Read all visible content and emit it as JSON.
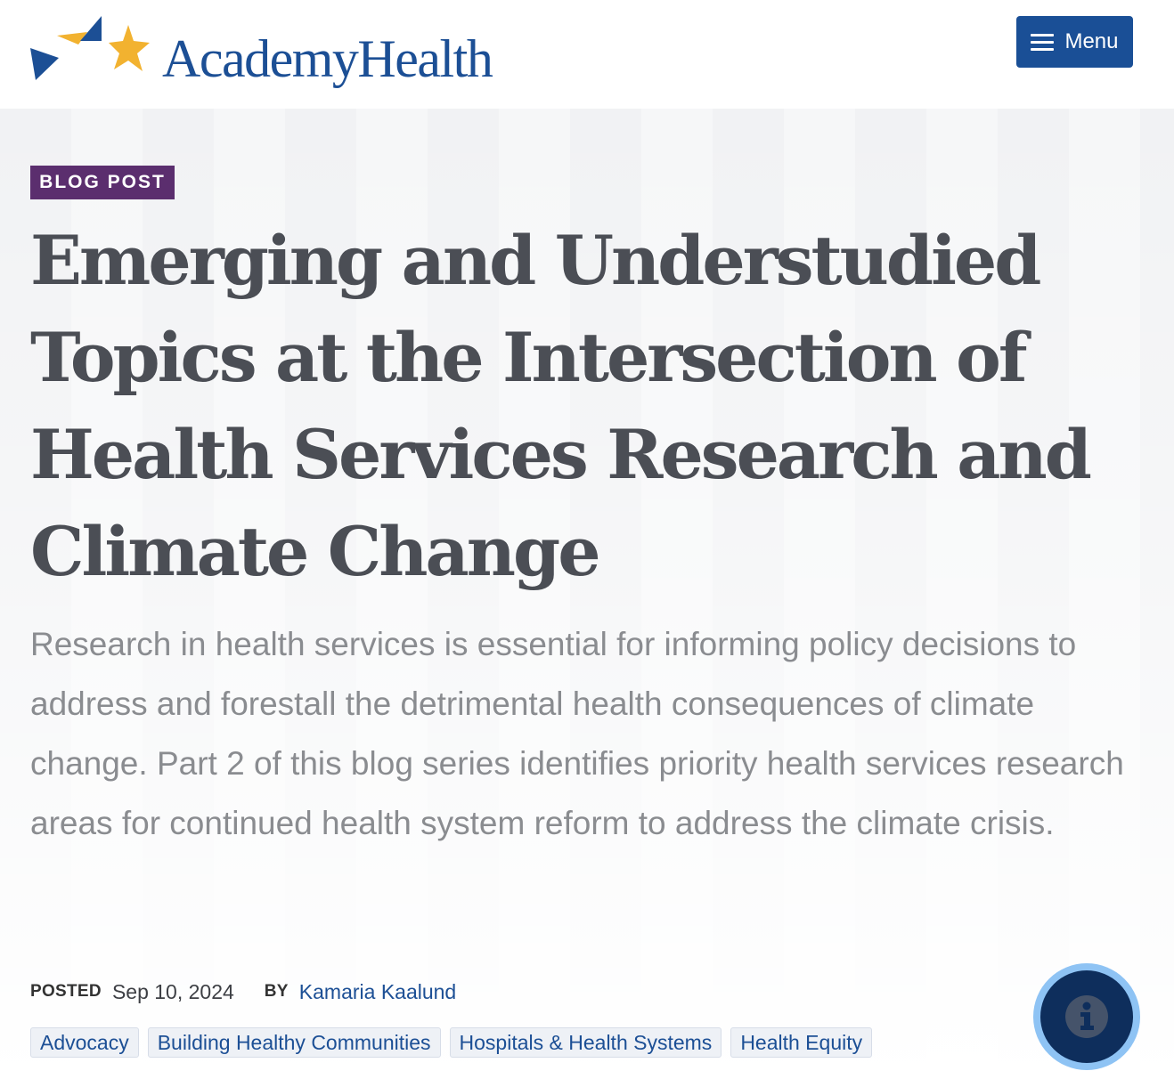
{
  "header": {
    "logo_text": "AcademyHealth",
    "menu_label": "Menu"
  },
  "colors": {
    "brand_blue": "#1c4f95",
    "badge_purple": "#5b2e6e",
    "star_gold": "#f2b230",
    "fab_ring": "#8ec3f4",
    "fab_dark": "#0e2e5c"
  },
  "article": {
    "badge": "BLOG POST",
    "title": "Emerging and Understudied Topics at the Intersection of Health Services Research and Climate Change",
    "dek": "Research in health services is essential for informing policy decisions to address and forestall the detrimental health consequences of climate change. Part 2 of this blog series identifies priority health services research areas for continued health system reform to address the climate crisis.",
    "posted_label": "POSTED",
    "posted_date": "Sep 10, 2024",
    "by_label": "BY",
    "author": "Kamaria Kaalund",
    "tags": [
      "Advocacy",
      "Building Healthy Communities",
      "Hospitals & Health Systems",
      "Health Equity"
    ]
  },
  "icons": {
    "logo_mark": "triangles-and-star-icon",
    "menu": "hamburger-icon",
    "fab": "info-icon"
  }
}
